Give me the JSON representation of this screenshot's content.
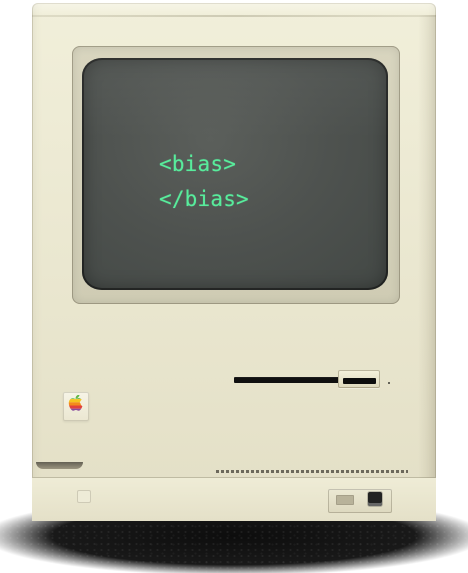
{
  "screen": {
    "lines": [
      "<bias>",
      "</bias>"
    ],
    "text_color": "#58ec9c"
  },
  "device": {
    "body_color": "#ebe8d1",
    "screen_color": "#4f5450",
    "logo": "rainbow-apple-icon"
  }
}
